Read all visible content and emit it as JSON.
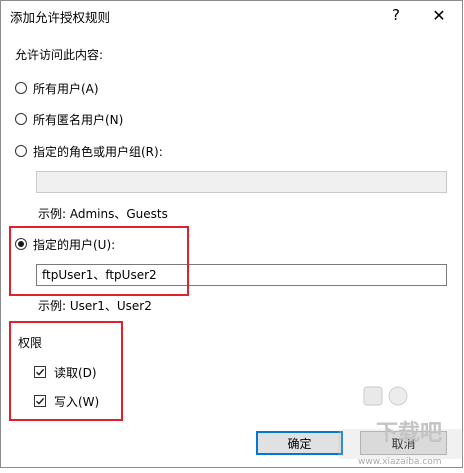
{
  "window": {
    "title": "添加允许授权规则",
    "help_label": "?",
    "close_label": "✕"
  },
  "access_section": {
    "label": "允许访问此内容:",
    "options": [
      {
        "label": "所有用户(A)",
        "checked": false
      },
      {
        "label": "所有匿名用户(N)",
        "checked": false
      },
      {
        "label": "指定的角色或用户组(R):",
        "checked": false
      },
      {
        "label": "指定的用户(U):",
        "checked": true
      }
    ],
    "roles_input": {
      "value": "",
      "enabled": false
    },
    "roles_example": "示例: Admins、Guests",
    "users_input": {
      "value": "ftpUser1、ftpUser2"
    },
    "users_example": "示例: User1、User2"
  },
  "permissions": {
    "label": "权限",
    "items": [
      {
        "label": "读取(D)",
        "checked": true
      },
      {
        "label": "写入(W)",
        "checked": true
      }
    ]
  },
  "buttons": {
    "ok": "确定",
    "cancel": "取消"
  },
  "watermark": {
    "text": "下载吧",
    "url": "www.xiazaiba.com"
  },
  "colors": {
    "highlight": "#e0202b",
    "focus": "#0078d7"
  }
}
